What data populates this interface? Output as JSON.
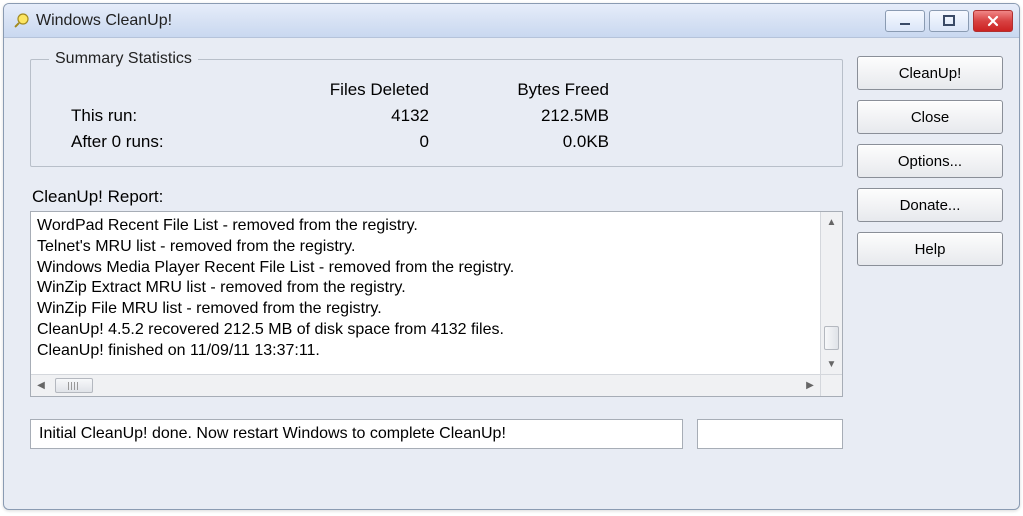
{
  "window": {
    "title": "Windows CleanUp!"
  },
  "stats": {
    "legend": "Summary Statistics",
    "headers": {
      "files": "Files Deleted",
      "bytes": "Bytes Freed"
    },
    "rows": [
      {
        "label": "This run:",
        "files": "4132",
        "bytes": "212.5MB"
      },
      {
        "label": "After 0 runs:",
        "files": "0",
        "bytes": "0.0KB"
      }
    ]
  },
  "report": {
    "label": "CleanUp! Report:",
    "lines": [
      "WordPad Recent File List - removed from the registry.",
      "Telnet's MRU list - removed from the registry.",
      "Windows Media Player Recent File List - removed from the registry.",
      "WinZip Extract MRU list - removed from the registry.",
      "WinZip File MRU list - removed from the registry.",
      "CleanUp! 4.5.2 recovered 212.5 MB of disk space from 4132 files.",
      "CleanUp! finished on 11/09/11 13:37:11."
    ]
  },
  "status": {
    "text": "Initial CleanUp! done. Now restart Windows to complete CleanUp!"
  },
  "buttons": {
    "cleanup": "CleanUp!",
    "close": "Close",
    "options": "Options...",
    "donate": "Donate...",
    "help": "Help"
  }
}
